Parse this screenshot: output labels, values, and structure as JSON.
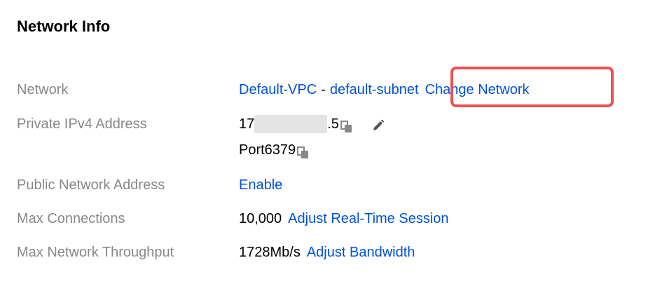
{
  "section": {
    "title": "Network Info"
  },
  "rows": {
    "network": {
      "label": "Network",
      "vpc": "Default-VPC",
      "separator": "-",
      "subnet": "default-subnet",
      "change_link": "Change Network"
    },
    "private_ip": {
      "label": "Private IPv4 Address",
      "ip_prefix": "17",
      "ip_suffix": ".5",
      "port": "Port6379"
    },
    "public_address": {
      "label": "Public Network Address",
      "enable_link": "Enable"
    },
    "max_connections": {
      "label": "Max Connections",
      "value": "10,000",
      "adjust_link": "Adjust Real-Time Session"
    },
    "max_throughput": {
      "label": "Max Network Throughput",
      "value": "1728Mb/s",
      "adjust_link": "Adjust Bandwidth"
    }
  },
  "icons": {
    "copy": "copy-icon",
    "edit": "pencil-icon"
  },
  "colors": {
    "link": "#0052d9",
    "label": "#888888",
    "highlight": "#f0504f"
  }
}
